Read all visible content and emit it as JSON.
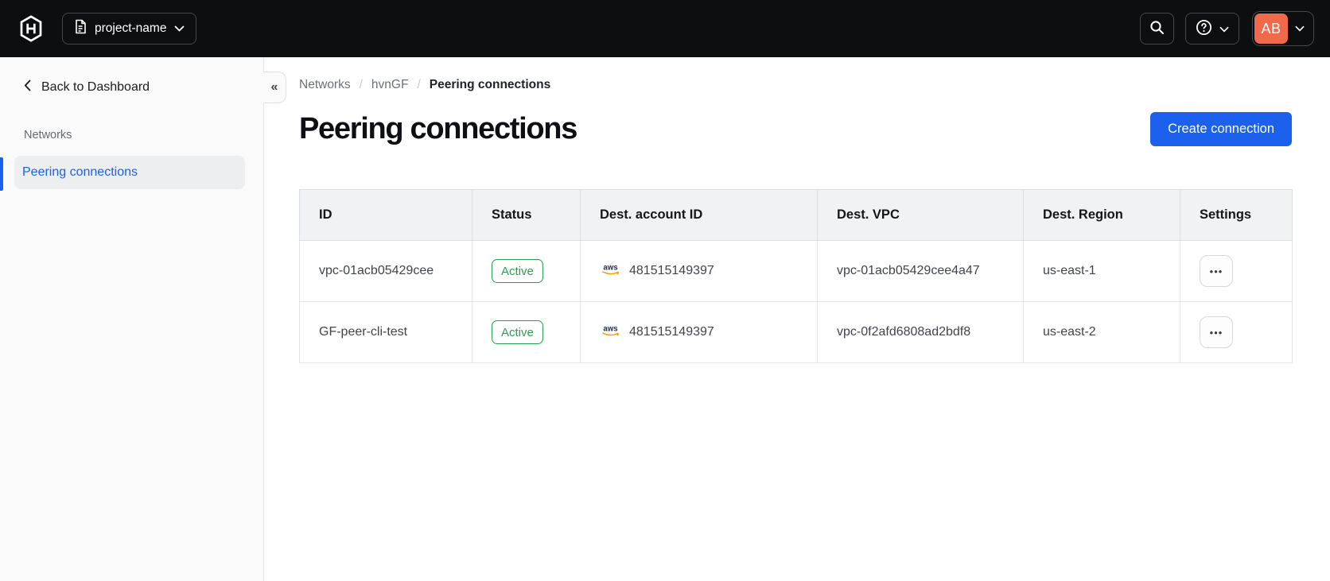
{
  "topbar": {
    "project_selector": {
      "label": "project-name"
    },
    "avatar": {
      "initials": "AB"
    }
  },
  "sidebar": {
    "back_label": "Back to Dashboard",
    "section_label": "Networks",
    "items": [
      {
        "label": "Peering connections",
        "active": true
      }
    ],
    "collapse_glyph": "«"
  },
  "breadcrumb": {
    "separator": "/",
    "items": [
      "Networks",
      "hvnGF",
      "Peering connections"
    ]
  },
  "page": {
    "title": "Peering connections",
    "create_button_label": "Create connection"
  },
  "table": {
    "columns": [
      "ID",
      "Status",
      "Dest. account ID",
      "Dest. VPC",
      "Dest. Region",
      "Settings"
    ],
    "rows": [
      {
        "id": "vpc-01acb05429cee",
        "status": "Active",
        "account_id": "481515149397",
        "vpc": "vpc-01acb05429cee4a47",
        "region": "us-east-1"
      },
      {
        "id": "GF-peer-cli-test",
        "status": "Active",
        "account_id": "481515149397",
        "vpc": "vpc-0f2afd6808ad2bdf8",
        "region": "us-east-2"
      }
    ],
    "row_menu_glyph": "•••"
  },
  "icons": {
    "aws_label": "aws"
  },
  "colors": {
    "accent_blue": "#1c61ee",
    "status_green": "#26a04d",
    "avatar_orange": "#f0694a",
    "topbar_bg": "#0d0e10",
    "aws_orange": "#ff9900"
  }
}
